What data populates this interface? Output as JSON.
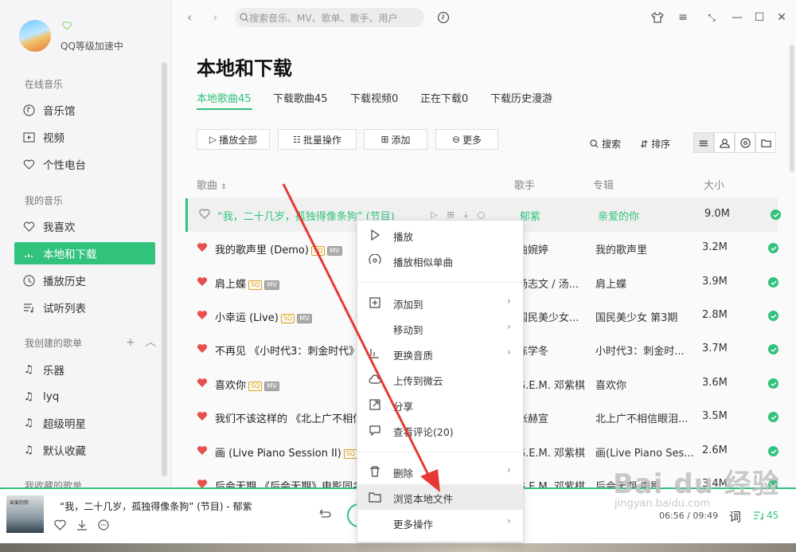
{
  "profile": {
    "name": "QQ等级加速中"
  },
  "sidebar": {
    "sections": [
      {
        "title": "在线音乐",
        "items": [
          {
            "label": "音乐馆",
            "icon": "music-hall-icon"
          },
          {
            "label": "视频",
            "icon": "video-icon"
          },
          {
            "label": "个性电台",
            "icon": "radio-icon"
          }
        ]
      },
      {
        "title": "我的音乐",
        "items": [
          {
            "label": "我喜欢",
            "icon": "heart-icon"
          },
          {
            "label": "本地和下载",
            "icon": "local-icon",
            "active": true
          },
          {
            "label": "播放历史",
            "icon": "history-icon"
          },
          {
            "label": "试听列表",
            "icon": "playlist-icon"
          }
        ]
      },
      {
        "title": "我创建的歌单",
        "items": [
          {
            "label": "乐器",
            "icon": "note-icon"
          },
          {
            "label": "lyq",
            "icon": "note-icon"
          },
          {
            "label": "超级明星",
            "icon": "note-icon"
          },
          {
            "label": "默认收藏",
            "icon": "note-icon"
          }
        ]
      },
      {
        "title": "我收藏的歌单",
        "items": []
      }
    ]
  },
  "search": {
    "placeholder": "搜索音乐、MV、歌单、歌手、用户"
  },
  "page": {
    "title": "本地和下载"
  },
  "tabs": [
    {
      "label": "本地歌曲45",
      "active": true
    },
    {
      "label": "下载歌曲45"
    },
    {
      "label": "下载视频0"
    },
    {
      "label": "正在下载0"
    },
    {
      "label": "下载历史漫游"
    }
  ],
  "toolbar": {
    "play_all": "播放全部",
    "batch": "批量操作",
    "add": "添加",
    "more": "更多",
    "search": "搜索",
    "sort": "排序"
  },
  "columns": {
    "song": "歌曲",
    "artist": "歌手",
    "album": "专辑",
    "size": "大小"
  },
  "songs": [
    {
      "title": "“我，二十几岁，孤独得像条狗” (节目)",
      "artist": "郁紫",
      "album": "亲爱的你",
      "size": "9.0M",
      "liked": false,
      "playing": true
    },
    {
      "title": "我的歌声里 (Demo)",
      "artist": "曲婉婷",
      "album": "我的歌声里",
      "size": "3.2M",
      "liked": true,
      "sq": true,
      "mv": true
    },
    {
      "title": "肩上蝶",
      "artist": "杨志文 / 汤...",
      "album": "肩上蝶",
      "size": "3.9M",
      "liked": true,
      "sq": true,
      "mv": true
    },
    {
      "title": "小幸运 (Live)",
      "artist": "国民美少女...",
      "album": "国民美少女 第3期",
      "size": "2.8M",
      "liked": true,
      "sq": true,
      "mv": true
    },
    {
      "title": "不再见 《小时代3：刺金时代》",
      "artist": "陈学冬",
      "album": "小时代3：刺金时...",
      "size": "3.7M",
      "liked": true
    },
    {
      "title": "喜欢你",
      "artist": "G.E.M. 邓紫棋",
      "album": "喜欢你",
      "size": "3.6M",
      "liked": true,
      "sq": true,
      "mv": true
    },
    {
      "title": "我们不该这样的 《北上广不相信",
      "artist": "张赫宣",
      "album": "北上广不相信眼泪...",
      "size": "3.5M",
      "liked": true
    },
    {
      "title": "画 (Live Piano Session II)",
      "artist": "G.E.M. 邓紫棋",
      "album": "画(Live Piano Ses...",
      "size": "2.6M",
      "liked": true,
      "sq": true
    },
    {
      "title": "后会无期 《后会无期》电影同名",
      "artist": "G.E.M. 邓紫棋",
      "album": "后会无期 电影...",
      "size": "3.4M",
      "liked": true
    }
  ],
  "context_menu": [
    {
      "label": "播放",
      "icon": "play-icon"
    },
    {
      "label": "播放相似单曲",
      "icon": "radio-icon"
    },
    {
      "label": "添加到",
      "icon": "add-icon",
      "submenu": true
    },
    {
      "label": "移动到",
      "icon": "",
      "submenu": true
    },
    {
      "label": "更换音质",
      "icon": "quality-icon",
      "submenu": true
    },
    {
      "label": "上传到微云",
      "icon": "cloud-icon"
    },
    {
      "label": "分享",
      "icon": "share-icon"
    },
    {
      "label": "查看评论(20)",
      "icon": "comment-icon"
    },
    {
      "label": "删除",
      "icon": "trash-icon",
      "submenu": true
    },
    {
      "label": "浏览本地文件",
      "icon": "folder-icon",
      "highlighted": true
    },
    {
      "label": "更多操作",
      "icon": "",
      "submenu": true
    }
  ],
  "player": {
    "title": "“我，二十几岁，孤独得像条狗” (节目) - 郁紫",
    "cover_text": "亲爱的你",
    "time": "06:56 / 09:49",
    "lyric": "词",
    "queue_count": "45"
  },
  "watermark": {
    "main": "Bai du 经验",
    "sub": "jingyan.baidu.com"
  },
  "colors": {
    "accent": "#31c27c",
    "arrow": "#e53935",
    "heart": "#e6504f"
  }
}
